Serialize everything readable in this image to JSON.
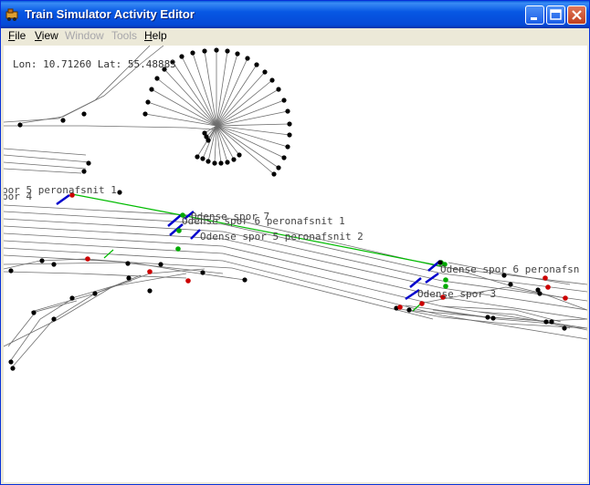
{
  "window": {
    "title": "Train Simulator Activity Editor",
    "minimize_label": "",
    "maximize_label": "",
    "close_label": ""
  },
  "menu": {
    "file_underline": "F",
    "file_rest": "ile",
    "view_underline": "V",
    "view_rest": "iew",
    "window_label": "Window",
    "tools_label": "Tools",
    "help_underline": "H",
    "help_rest": "elp"
  },
  "status": {
    "coordinates": "Lon: 10.71260 Lat: 55.48883"
  },
  "map_labels": {
    "spor5_pn1": "por 5 peronafsnit 1",
    "spor4": "por 4",
    "odense_spor7": "Odense spor 7",
    "odense_spor6_pn1": "Odense spor 6 peronafsnit 1",
    "odense_spor5_pn2": "Odense spor 5 peronafsnit 2",
    "odense_spor6_pn_right": "Odense spor 6 peronafsn",
    "odense_spor3": "Odense spor 3"
  },
  "colors": {
    "track": "#6e6e6e",
    "junction": "#000000",
    "signal": "#cc0000",
    "path": "#00bb00",
    "platform_marker": "#0000cc"
  }
}
